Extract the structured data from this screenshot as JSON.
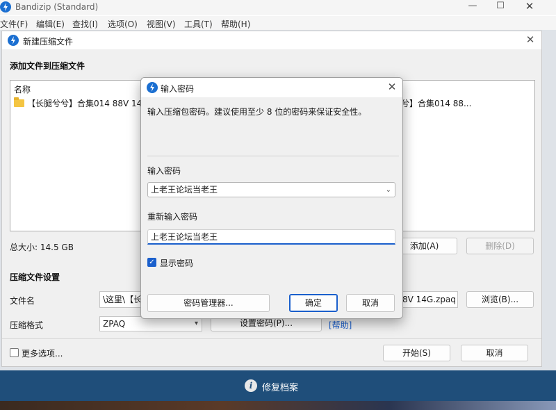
{
  "app": {
    "title": "Bandizip (Standard)",
    "menu": [
      "文件(F)",
      "编辑(E)",
      "查找(I)",
      "选项(O)",
      "视图(V)",
      "工具(T)",
      "帮助(H)"
    ],
    "window_buttons": {
      "minimize": "—",
      "maximize": "☐",
      "close": "✕"
    },
    "bottom_bar": {
      "label": "修复档案",
      "icon": "info-icon"
    }
  },
  "new_archive_dialog": {
    "title": "新建压缩文件",
    "close": "✕",
    "add_files_heading": "添加文件到压缩文件",
    "file_list": {
      "column_header": "名称",
      "rows": [
        {
          "icon": "folder-icon",
          "name_left": "【长腿兮兮】合集014 88V 14",
          "name_right": "兮】合集014 88..."
        }
      ]
    },
    "total_size_label": "总大小: 14.5 GB",
    "add_button": "添加(A)",
    "delete_button": "删除(D)",
    "settings_heading": "压缩文件设置",
    "filename_label": "文件名",
    "filename_value_left": "\\这里\\【长",
    "filename_value_right": "8V 14G.zpaq",
    "browse_button": "浏览(B)...",
    "format_label": "压缩格式",
    "format_value": "ZPAQ",
    "set_password_button": "设置密码(P)...",
    "help_link": "[帮助]",
    "more_options_label": "更多选项...",
    "start_button": "开始(S)",
    "cancel_button": "取消"
  },
  "password_dialog": {
    "title": "输入密码",
    "close": "✕",
    "description": "输入压缩包密码。建议使用至少 8 位的密码来保证安全性。",
    "password_label": "输入密码",
    "password_value": "上老王论坛当老王",
    "reenter_label": "重新输入密码",
    "reenter_value": "上老王论坛当老王",
    "show_password_label": "显示密码",
    "show_password_checked": true,
    "manager_button": "密码管理器...",
    "ok_button": "确定",
    "cancel_button": "取消"
  },
  "colors": {
    "accent": "#1a5fcc",
    "bottom_bar": "#1f4e7a",
    "dialog_bg": "#f0f0f0"
  }
}
